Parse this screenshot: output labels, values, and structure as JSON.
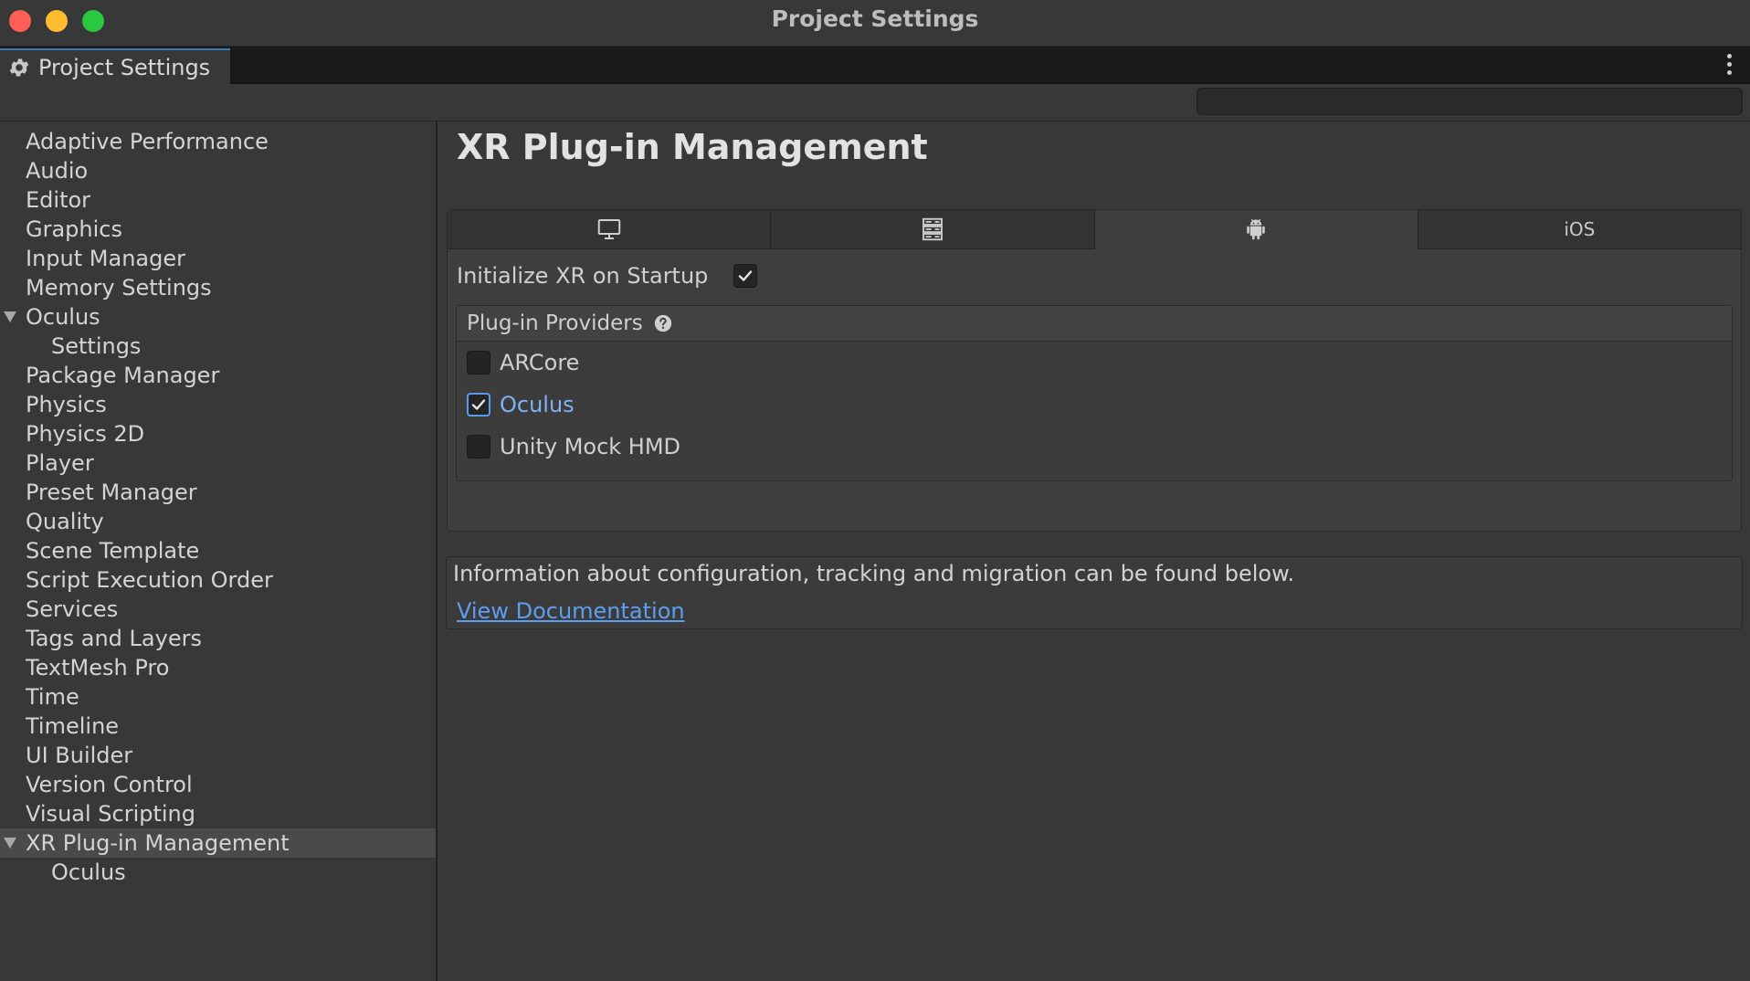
{
  "window": {
    "title": "Project Settings"
  },
  "tab": {
    "label": "Project Settings"
  },
  "search": {
    "value": "",
    "placeholder": ""
  },
  "sidebar": {
    "items": [
      {
        "label": "Adaptive Performance",
        "level": 1,
        "expanded": false,
        "selected": false
      },
      {
        "label": "Audio",
        "level": 1,
        "selected": false
      },
      {
        "label": "Editor",
        "level": 1,
        "selected": false
      },
      {
        "label": "Graphics",
        "level": 1,
        "selected": false
      },
      {
        "label": "Input Manager",
        "level": 1,
        "selected": false
      },
      {
        "label": "Memory Settings",
        "level": 1,
        "selected": false
      },
      {
        "label": "Oculus",
        "level": 1,
        "expanded": true,
        "selected": false
      },
      {
        "label": "Settings",
        "level": 2,
        "selected": false
      },
      {
        "label": "Package Manager",
        "level": 1,
        "selected": false
      },
      {
        "label": "Physics",
        "level": 1,
        "selected": false
      },
      {
        "label": "Physics 2D",
        "level": 1,
        "selected": false
      },
      {
        "label": "Player",
        "level": 1,
        "selected": false
      },
      {
        "label": "Preset Manager",
        "level": 1,
        "selected": false
      },
      {
        "label": "Quality",
        "level": 1,
        "selected": false
      },
      {
        "label": "Scene Template",
        "level": 1,
        "selected": false
      },
      {
        "label": "Script Execution Order",
        "level": 1,
        "selected": false
      },
      {
        "label": "Services",
        "level": 1,
        "selected": false
      },
      {
        "label": "Tags and Layers",
        "level": 1,
        "selected": false
      },
      {
        "label": "TextMesh Pro",
        "level": 1,
        "selected": false
      },
      {
        "label": "Time",
        "level": 1,
        "selected": false
      },
      {
        "label": "Timeline",
        "level": 1,
        "selected": false
      },
      {
        "label": "UI Builder",
        "level": 1,
        "selected": false
      },
      {
        "label": "Version Control",
        "level": 1,
        "selected": false
      },
      {
        "label": "Visual Scripting",
        "level": 1,
        "selected": false
      },
      {
        "label": "XR Plug-in Management",
        "level": 1,
        "expanded": true,
        "selected": true
      },
      {
        "label": "Oculus",
        "level": 2,
        "selected": false
      }
    ]
  },
  "main": {
    "title": "XR Plug-in Management",
    "platform_tabs": [
      {
        "icon": "desktop-icon",
        "label": "",
        "active": false
      },
      {
        "icon": "server-icon",
        "label": "",
        "active": false
      },
      {
        "icon": "android-icon",
        "label": "",
        "active": true
      },
      {
        "icon": "",
        "label": "iOS",
        "active": false
      }
    ],
    "init_xr": {
      "label": "Initialize XR on Startup",
      "checked": true
    },
    "providers": {
      "header": "Plug-in Providers",
      "items": [
        {
          "label": "ARCore",
          "checked": false
        },
        {
          "label": "Oculus",
          "checked": true
        },
        {
          "label": "Unity Mock HMD",
          "checked": false
        }
      ]
    },
    "info": {
      "text": "Information about configuration, tracking and migration can be found below.",
      "link": "View Documentation"
    }
  },
  "colors": {
    "accent": "#3a79bb",
    "link": "#5e9ef0",
    "checked_label": "#7fb1f5",
    "background": "#383838"
  }
}
